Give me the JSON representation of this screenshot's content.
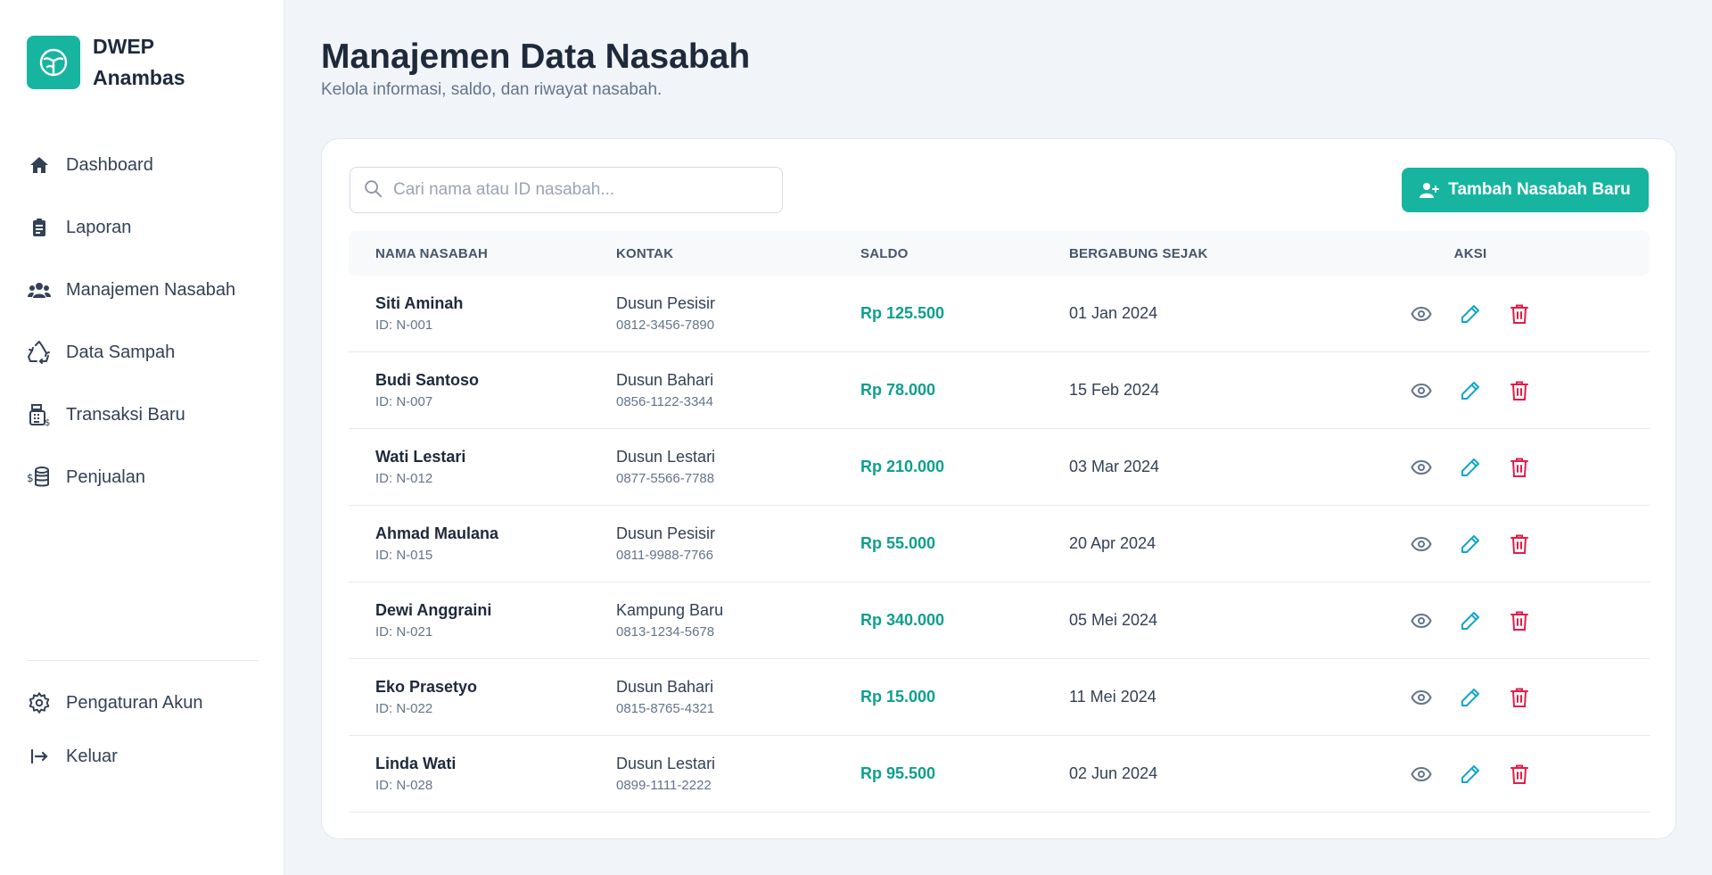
{
  "app": {
    "brand_line1": "DWEP",
    "brand_line2": "Anambas",
    "accent_color": "#17b5a0"
  },
  "sidebar": {
    "items": [
      {
        "label": "Dashboard",
        "icon": "home-icon"
      },
      {
        "label": "Laporan",
        "icon": "clipboard-icon"
      },
      {
        "label": "Manajemen Nasabah",
        "icon": "users-icon"
      },
      {
        "label": "Data Sampah",
        "icon": "recycle-icon"
      },
      {
        "label": "Transaksi Baru",
        "icon": "cash-register-icon"
      },
      {
        "label": "Penjualan",
        "icon": "coins-icon"
      }
    ],
    "bottom_items": [
      {
        "label": "Pengaturan Akun",
        "icon": "gear-icon"
      },
      {
        "label": "Keluar",
        "icon": "logout-icon"
      }
    ]
  },
  "header": {
    "title": "Manajemen Data Nasabah",
    "subtitle": "Kelola informasi, saldo, dan riwayat nasabah."
  },
  "toolbar": {
    "search_placeholder": "Cari nama atau ID nasabah...",
    "search_value": "",
    "add_label": "Tambah Nasabah Baru"
  },
  "table": {
    "columns": [
      "Nama Nasabah",
      "Kontak",
      "Saldo",
      "Bergabung Sejak",
      "Aksi"
    ],
    "rows": [
      {
        "name": "Siti Aminah",
        "id": "ID: N-001",
        "address": "Dusun Pesisir",
        "phone": "0812-3456-7890",
        "saldo": "Rp 125.500",
        "joined": "01 Jan 2024"
      },
      {
        "name": "Budi Santoso",
        "id": "ID: N-007",
        "address": "Dusun Bahari",
        "phone": "0856-1122-3344",
        "saldo": "Rp 78.000",
        "joined": "15 Feb 2024"
      },
      {
        "name": "Wati Lestari",
        "id": "ID: N-012",
        "address": "Dusun Lestari",
        "phone": "0877-5566-7788",
        "saldo": "Rp 210.000",
        "joined": "03 Mar 2024"
      },
      {
        "name": "Ahmad Maulana",
        "id": "ID: N-015",
        "address": "Dusun Pesisir",
        "phone": "0811-9988-7766",
        "saldo": "Rp 55.000",
        "joined": "20 Apr 2024"
      },
      {
        "name": "Dewi Anggraini",
        "id": "ID: N-021",
        "address": "Kampung Baru",
        "phone": "0813-1234-5678",
        "saldo": "Rp 340.000",
        "joined": "05 Mei 2024"
      },
      {
        "name": "Eko Prasetyo",
        "id": "ID: N-022",
        "address": "Dusun Bahari",
        "phone": "0815-8765-4321",
        "saldo": "Rp 15.000",
        "joined": "11 Mei 2024"
      },
      {
        "name": "Linda Wati",
        "id": "ID: N-028",
        "address": "Dusun Lestari",
        "phone": "0899-1111-2222",
        "saldo": "Rp 95.500",
        "joined": "02 Jun 2024"
      }
    ],
    "action_icons": [
      "eye-icon",
      "pencil-icon",
      "trash-icon"
    ]
  }
}
